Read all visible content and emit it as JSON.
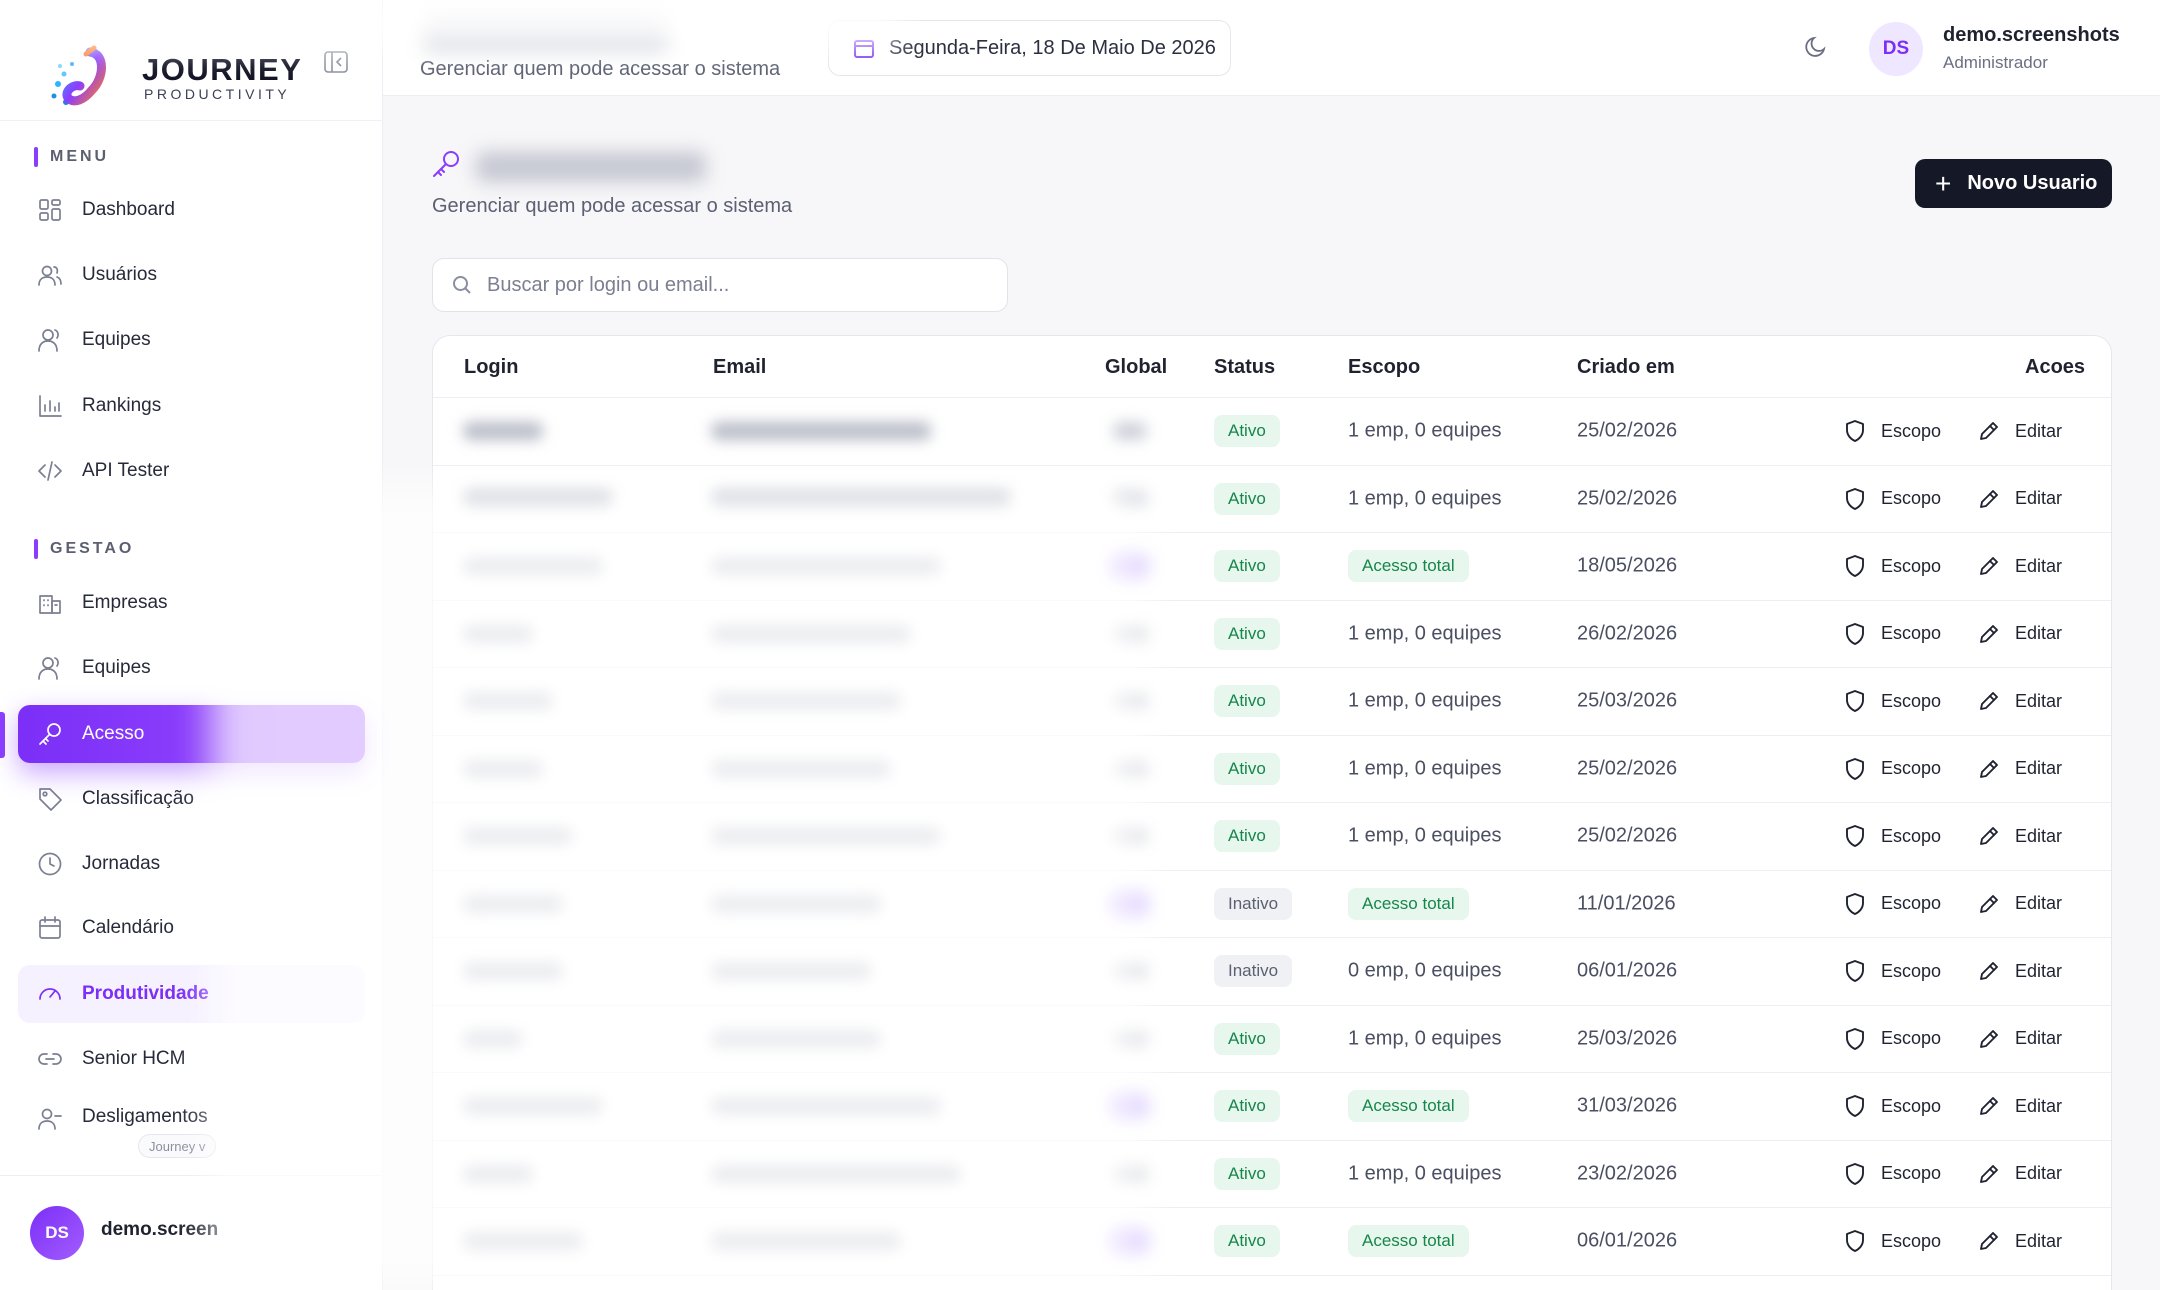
{
  "brand": {
    "title": "JOURNEY",
    "subtitle": "PRODUCTIVITY"
  },
  "sidebar": {
    "sections": [
      {
        "label": "MENU"
      },
      {
        "label": "GESTAO"
      }
    ],
    "items": [
      {
        "label": "Dashboard",
        "icon": "dashboard-icon"
      },
      {
        "label": "Usuários",
        "icon": "users-icon"
      },
      {
        "label": "Equipes",
        "icon": "team-icon"
      },
      {
        "label": "Rankings",
        "icon": "bar-chart-icon"
      },
      {
        "label": "API Tester",
        "icon": "code-icon"
      },
      {
        "label": "Empresas",
        "icon": "building-icon"
      },
      {
        "label": "Equipes",
        "icon": "team-icon"
      },
      {
        "label": "Acesso",
        "icon": "key-icon",
        "state": "active"
      },
      {
        "label": "Classificação",
        "icon": "tag-icon"
      },
      {
        "label": "Jornadas",
        "icon": "clock-icon"
      },
      {
        "label": "Calendário",
        "icon": "calendar-icon"
      },
      {
        "label": "Produtividade",
        "icon": "gauge-icon",
        "state": "highlight"
      },
      {
        "label": "Senior HCM",
        "icon": "link-icon"
      },
      {
        "label": "Desligamentos",
        "icon": "user-minus-icon"
      }
    ],
    "version_label": "Journey v",
    "footer_user": {
      "initials": "DS",
      "name": "demo.screen"
    }
  },
  "topbar": {
    "subtitle": "Gerenciar quem pode acessar o sistema",
    "date": "Segunda-Feira, 18 De Maio De 2026",
    "user": {
      "initials": "DS",
      "name": "demo.screenshots",
      "role": "Administrador"
    }
  },
  "page": {
    "subtitle": "Gerenciar quem pode acessar o sistema",
    "new_button": "Novo Usuario",
    "search_placeholder": "Buscar por login ou email..."
  },
  "table": {
    "columns": [
      "Login",
      "Email",
      "Global",
      "Status",
      "Escopo",
      "Criado em",
      "Acoes"
    ],
    "action_labels": {
      "scope": "Escopo",
      "edit": "Editar"
    },
    "rows": [
      {
        "status": "Ativo",
        "escopo": "1 emp, 0 equipes",
        "escopo_badge": false,
        "criado": "25/02/2026"
      },
      {
        "status": "Ativo",
        "escopo": "1 emp, 0 equipes",
        "escopo_badge": false,
        "criado": "25/02/2026"
      },
      {
        "status": "Ativo",
        "escopo": "Acesso total",
        "escopo_badge": true,
        "criado": "18/05/2026"
      },
      {
        "status": "Ativo",
        "escopo": "1 emp, 0 equipes",
        "escopo_badge": false,
        "criado": "26/02/2026"
      },
      {
        "status": "Ativo",
        "escopo": "1 emp, 0 equipes",
        "escopo_badge": false,
        "criado": "25/03/2026"
      },
      {
        "status": "Ativo",
        "escopo": "1 emp, 0 equipes",
        "escopo_badge": false,
        "criado": "25/02/2026"
      },
      {
        "status": "Ativo",
        "escopo": "1 emp, 0 equipes",
        "escopo_badge": false,
        "criado": "25/02/2026"
      },
      {
        "status": "Inativo",
        "escopo": "Acesso total",
        "escopo_badge": true,
        "criado": "11/01/2026"
      },
      {
        "status": "Inativo",
        "escopo": "0 emp, 0 equipes",
        "escopo_badge": false,
        "criado": "06/01/2026"
      },
      {
        "status": "Ativo",
        "escopo": "1 emp, 0 equipes",
        "escopo_badge": false,
        "criado": "25/03/2026"
      },
      {
        "status": "Ativo",
        "escopo": "Acesso total",
        "escopo_badge": true,
        "criado": "31/03/2026"
      },
      {
        "status": "Ativo",
        "escopo": "1 emp, 0 equipes",
        "escopo_badge": false,
        "criado": "23/02/2026"
      },
      {
        "status": "Ativo",
        "escopo": "Acesso total",
        "escopo_badge": true,
        "criado": "06/01/2026"
      }
    ]
  },
  "colors": {
    "accent": "#8b3dff",
    "button_dark": "#151827",
    "success": "#16864a",
    "success_bg": "#e8f7ee"
  }
}
